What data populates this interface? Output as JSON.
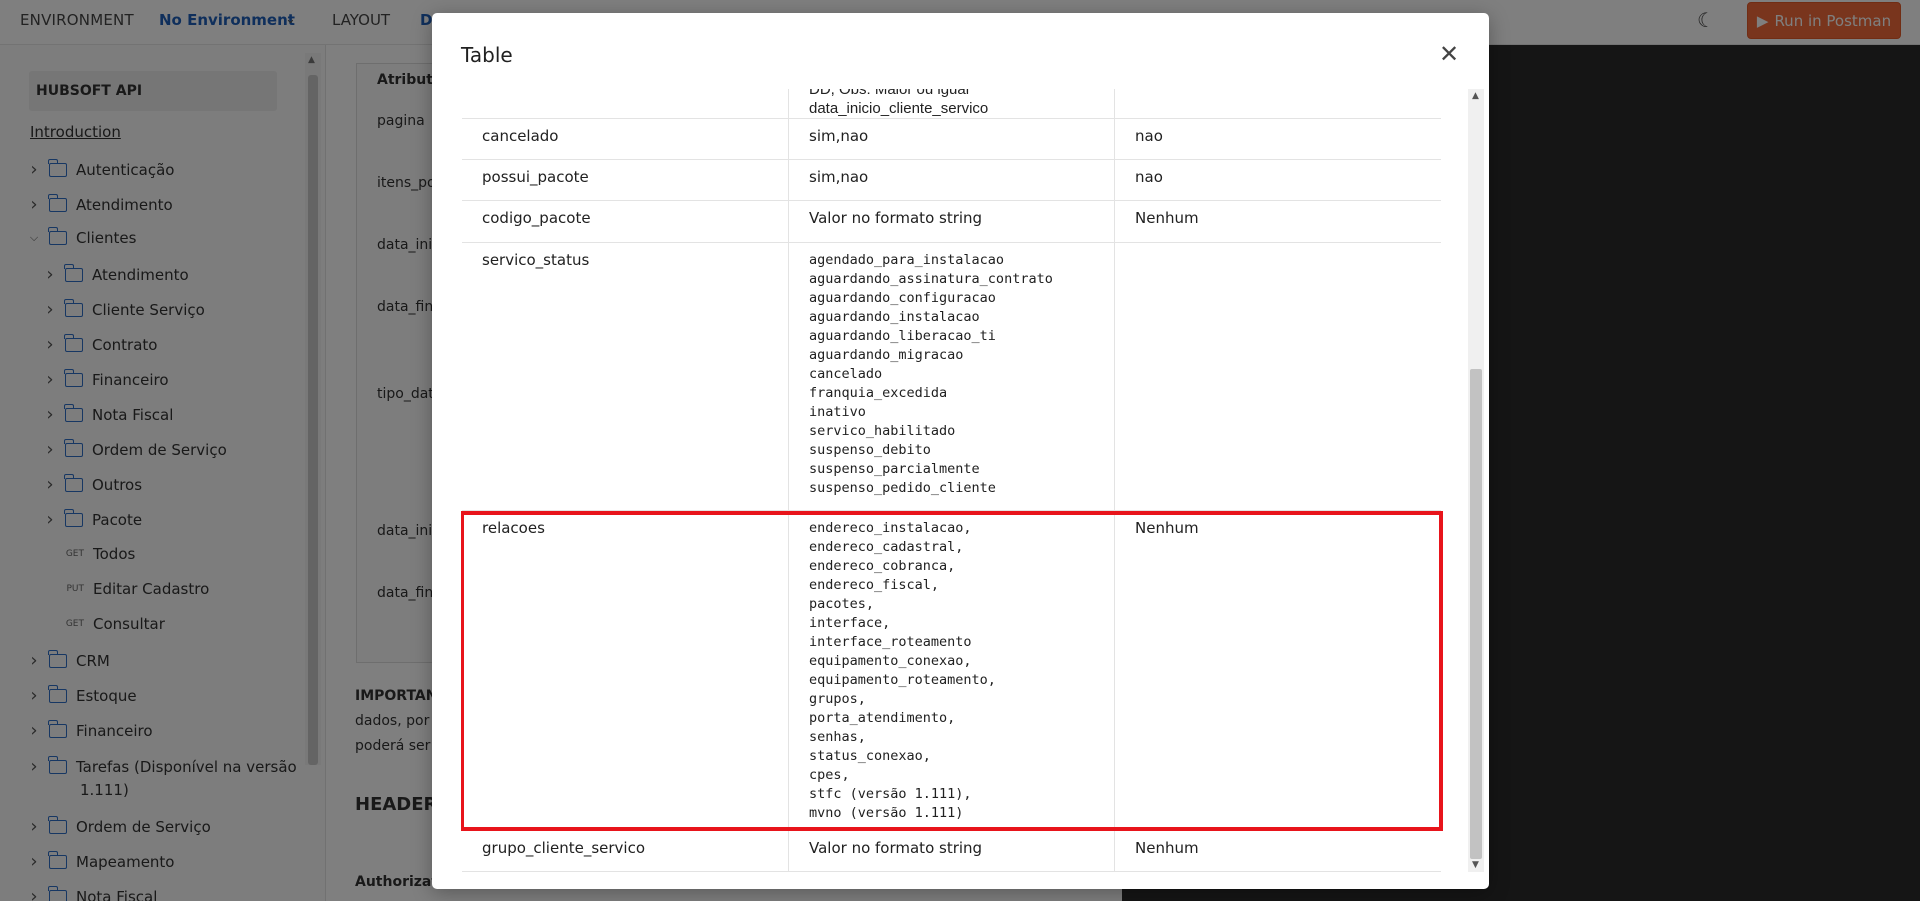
{
  "topbar": {
    "environment_label": "ENVIRONMENT",
    "environment_value": "No Environment",
    "layout_label": "LAYOUT",
    "tab_partial": "D",
    "run_button": "Run in Postman"
  },
  "sidebar": {
    "api_title": "HUBSOFT API",
    "intro": "Introduction",
    "items": [
      {
        "label": "Autenticação",
        "type": "folder"
      },
      {
        "label": "Atendimento",
        "type": "folder"
      },
      {
        "label": "Clientes",
        "type": "folder",
        "expanded": true
      },
      {
        "label": "Atendimento",
        "type": "folder"
      },
      {
        "label": "Cliente Serviço",
        "type": "folder"
      },
      {
        "label": "Contrato",
        "type": "folder"
      },
      {
        "label": "Financeiro",
        "type": "folder"
      },
      {
        "label": "Nota Fiscal",
        "type": "folder"
      },
      {
        "label": "Ordem de Serviço",
        "type": "folder"
      },
      {
        "label": "Outros",
        "type": "folder"
      },
      {
        "label": "Pacote",
        "type": "folder"
      },
      {
        "label": "Todos",
        "method": "GET"
      },
      {
        "label": "Editar Cadastro",
        "method": "PUT"
      },
      {
        "label": "Consultar",
        "method": "GET"
      },
      {
        "label": "CRM",
        "type": "folder"
      },
      {
        "label": "Estoque",
        "type": "folder"
      },
      {
        "label": "Financeiro",
        "type": "folder"
      },
      {
        "label": "Tarefas (Disponível na versão",
        "label_line2": "1.111)",
        "type": "folder"
      },
      {
        "label": "Ordem de Serviço",
        "type": "folder"
      },
      {
        "label": "Mapeamento",
        "type": "folder"
      },
      {
        "label": "Nota Fiscal",
        "type": "folder"
      }
    ]
  },
  "background": {
    "table_header": "Atribut",
    "cells": [
      "pagina",
      "itens_po",
      "data_ini",
      "data_fin",
      "tipo_dat",
      "data_ini",
      "data_fin"
    ],
    "important": "IMPORTAN",
    "text_line1": "dados, por",
    "text_line2": "poderá ser",
    "headers": "HEADERS",
    "authorization": "Authorizat"
  },
  "modal": {
    "title": "Table",
    "rows": [
      {
        "name": "",
        "values": [
          "DD, Obs: Maior ou igual",
          "data_inicio_cliente_servico"
        ],
        "default": ""
      },
      {
        "name": "cancelado",
        "value": "sim,nao",
        "default": "nao"
      },
      {
        "name": "possui_pacote",
        "value": "sim,nao",
        "default": "nao"
      },
      {
        "name": "codigo_pacote",
        "value": "Valor no formato string",
        "default": "Nenhum"
      },
      {
        "name": "servico_status",
        "values": [
          "agendado_para_instalacao",
          "aguardando_assinatura_contrato",
          "aguardando_configuracao",
          "aguardando_instalacao",
          "aguardando_liberacao_ti",
          "aguardando_migracao",
          "cancelado",
          "franquia_excedida",
          "inativo",
          "servico_habilitado",
          "suspenso_debito",
          "suspenso_parcialmente",
          "suspenso_pedido_cliente"
        ],
        "default": ""
      },
      {
        "name": "relacoes",
        "values": [
          "endereco_instalacao,",
          "endereco_cadastral,",
          "endereco_cobranca,",
          "endereco_fiscal,",
          "pacotes,",
          "interface,",
          "interface_roteamento",
          "equipamento_conexao,",
          "equipamento_roteamento,",
          "grupos,",
          "porta_atendimento,",
          "senhas,",
          "status_conexao,",
          "cpes,",
          "stfc (versão 1.111),",
          "mvno (versão 1.111)"
        ],
        "default": "Nenhum"
      },
      {
        "name": "grupo_cliente_servico",
        "value": "Valor no formato string",
        "default": "Nenhum"
      }
    ]
  }
}
